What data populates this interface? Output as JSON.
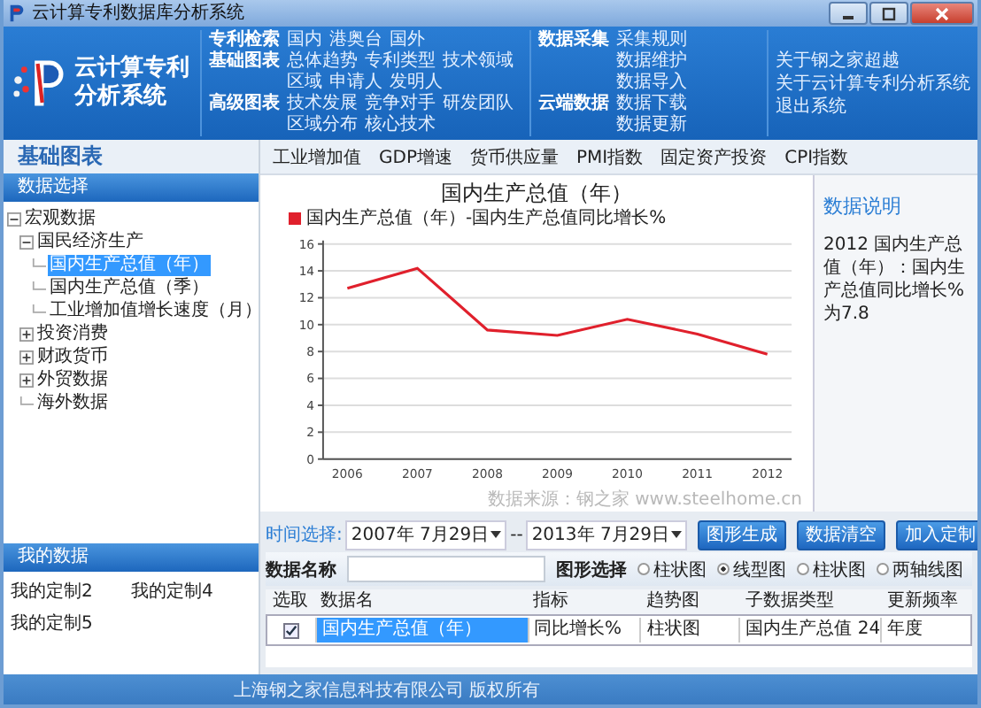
{
  "window": {
    "title": "云计算专利数据库分析系统"
  },
  "header": {
    "logo_lines": [
      "云计算专利",
      "分析系统"
    ],
    "menu_groups": [
      {
        "label": "专利检索",
        "items": [
          "国内",
          "港奥台",
          "国外"
        ]
      },
      {
        "label": "基础图表",
        "items": [
          "总体趋势",
          "专利类型",
          "技术领域",
          "区域",
          "申请人",
          "发明人"
        ]
      },
      {
        "label": "高级图表",
        "items": [
          "技术发展",
          "竞争对手",
          "研发团队",
          "区域分布",
          "核心技术"
        ]
      }
    ],
    "data_groups": [
      {
        "label": "数据采集",
        "items": [
          "采集规则",
          "数据维护",
          "数据导入"
        ]
      },
      {
        "label": "云端数据",
        "items": [
          "数据下载",
          "数据更新"
        ]
      }
    ],
    "about_links": [
      "关于钢之家超越",
      "关于云计算专利分析系统",
      "退出系统"
    ]
  },
  "sidebar": {
    "title": "基础图表",
    "data_section": "数据选择",
    "tree": [
      {
        "label": "宏观数据",
        "expanded": true,
        "selected": false,
        "children": [
          {
            "label": "国民经济生产",
            "expanded": true,
            "selected": false,
            "children": [
              {
                "label": "国内生产总值（年）",
                "selected": true
              },
              {
                "label": "国内生产总值（季）",
                "selected": false
              },
              {
                "label": "工业增加值增长速度（月）",
                "selected": false
              }
            ]
          },
          {
            "label": "投资消费",
            "expanded": false,
            "selected": false
          },
          {
            "label": "财政货币",
            "expanded": false,
            "selected": false
          },
          {
            "label": "外贸数据",
            "expanded": false,
            "selected": false
          },
          {
            "label": "海外数据",
            "selected": false
          }
        ]
      }
    ],
    "my_data_title": "我的数据",
    "my_data": [
      "我的定制2",
      "我的定制4",
      "我的定制5"
    ]
  },
  "tabs": [
    {
      "label": "工业增加值",
      "selected": false
    },
    {
      "label": "GDP增速",
      "selected": false
    },
    {
      "label": "货币供应量",
      "selected": false
    },
    {
      "label": "PMI指数",
      "selected": false
    },
    {
      "label": "固定资产投资",
      "selected": false
    },
    {
      "label": "CPI指数",
      "selected": false
    }
  ],
  "chart": {
    "chart_data": {
      "type": "line",
      "title": "国内生产总值（年）",
      "categories": [
        "2006",
        "2007",
        "2008",
        "2009",
        "2010",
        "2011",
        "2012"
      ],
      "series": [
        {
          "name": "国内生产总值（年）-国内生产总值同比增长%",
          "color": "#e0202c",
          "values": [
            12.7,
            14.2,
            9.6,
            9.2,
            10.4,
            9.3,
            7.8
          ]
        }
      ],
      "ylim": [
        0,
        16
      ],
      "grid": true,
      "yticks": [
        0,
        2,
        4,
        6,
        8,
        10,
        12,
        14,
        16
      ]
    },
    "source": "数据来源：钢之家 www.steelhome.cn"
  },
  "info": {
    "title": "数据说明",
    "text": "2012 国内生产总值（年）：国内生产总值同比增长%为7.8"
  },
  "controls": {
    "time_label": "时间选择:",
    "start_date": "2007年 7月29日",
    "separator": "--",
    "end_date": "2013年 7月29日",
    "buttons": [
      "图形生成",
      "数据清空",
      "加入定制"
    ],
    "name_label": "数据名称",
    "chart_type_label": "图形选择",
    "chart_types": [
      {
        "label": "柱状图",
        "selected": false
      },
      {
        "label": "线型图",
        "selected": true
      },
      {
        "label": "柱状图",
        "selected": false
      },
      {
        "label": "两轴线图",
        "selected": false
      }
    ]
  },
  "table": {
    "columns": [
      "选取",
      "数据名",
      "指标",
      "趋势图",
      "子数据类型",
      "更新频率"
    ],
    "rows": [
      {
        "checked": true,
        "selected": true,
        "cells": [
          "",
          "国内生产总值（年）",
          "同比增长%",
          "柱状图",
          "国内生产总值 24",
          "年度"
        ]
      }
    ]
  },
  "footer": "上海钢之家信息科技有限公司 版权所有"
}
